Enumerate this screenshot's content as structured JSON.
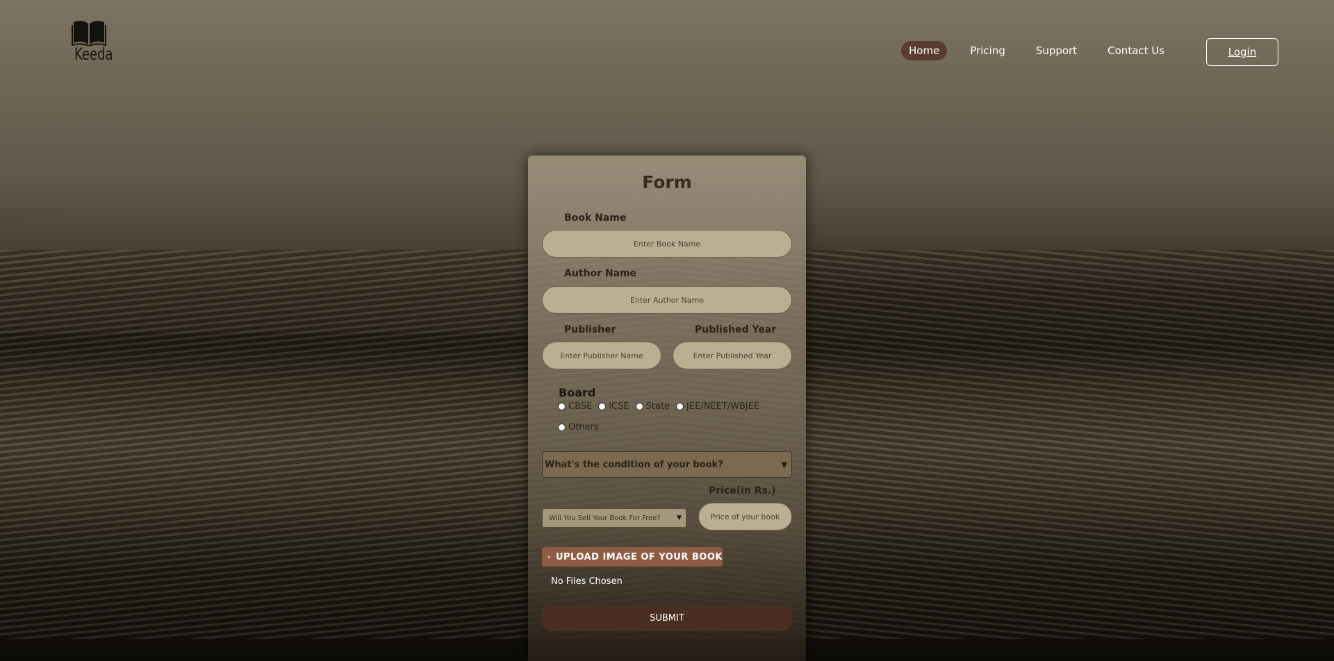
{
  "brand": {
    "name": "Keeda",
    "icon": "open-book-icon"
  },
  "nav": {
    "items": [
      {
        "label": "Home",
        "active": true
      },
      {
        "label": "Pricing",
        "active": false
      },
      {
        "label": "Support",
        "active": false
      },
      {
        "label": "Contact Us",
        "active": false
      }
    ],
    "login_label": "Login"
  },
  "form": {
    "title": "Form",
    "book_name": {
      "label": "Book Name",
      "placeholder": "Enter Book Name"
    },
    "author_name": {
      "label": "Author Name",
      "placeholder": "Enter Author Name"
    },
    "publisher": {
      "label": "Publisher",
      "placeholder": "Enter Publisher Name"
    },
    "published_year": {
      "label": "Published Year",
      "placeholder": "Enter Published Year"
    },
    "board": {
      "label": "Board",
      "options": [
        "CBSE",
        "ICSE",
        "State",
        "JEE/NEET/WBJEE",
        "Others"
      ]
    },
    "condition_select": {
      "value": "What's the condition of your book?"
    },
    "price": {
      "label": "Price(in Rs.)",
      "placeholder": "Price of your book"
    },
    "free_select": {
      "value": "Will You Sell Your Book For Free?"
    },
    "upload": {
      "label": "UPLOAD IMAGE OF YOUR BOOK",
      "status": "No Files Chosen"
    },
    "submit_label": "SUBMIT"
  },
  "colors": {
    "active_nav": "#5a3d2f",
    "input_bg": "#bcae92",
    "upload_button": "#8e5c45",
    "submit_button": "#4a2e22"
  }
}
